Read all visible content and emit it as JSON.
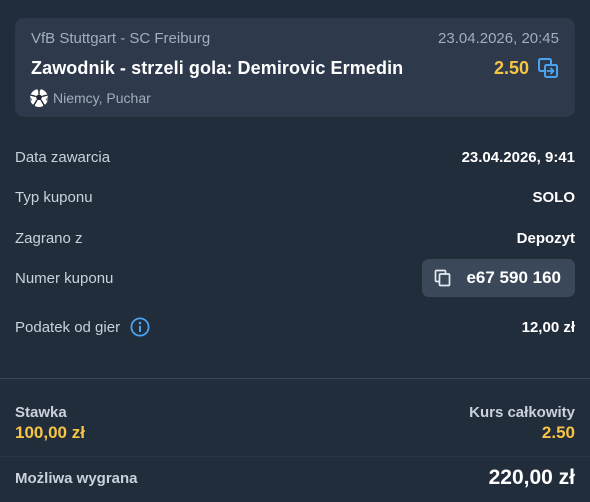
{
  "bet": {
    "match": "VfB Stuttgart - SC Freiburg",
    "datetime": "23.04.2026, 20:45",
    "selection": "Zawodnik - strzeli gola: Demirovic Ermedin",
    "odds": "2.50",
    "league": "Niemcy, Puchar",
    "sport_icon": "soccer-ball-icon"
  },
  "details": {
    "placed_label": "Data zawarcia",
    "placed_value": "23.04.2026, 9:41",
    "type_label": "Typ kuponu",
    "type_value": "SOLO",
    "played_from_label": "Zagrano z",
    "played_from_value": "Depozyt",
    "coupon_label": "Numer kuponu",
    "coupon_value": "e67 590 160",
    "tax_label": "Podatek od gier",
    "tax_value": "12,00 zł"
  },
  "summary": {
    "stake_label": "Stawka",
    "stake_value": "100,00 zł",
    "total_odds_label": "Kurs całkowity",
    "total_odds_value": "2.50",
    "win_label": "Możliwa wygrana",
    "win_value": "220,00 zł"
  },
  "colors": {
    "background": "#222d3c",
    "card": "#2e3a4c",
    "accent_yellow": "#f6c544",
    "accent_blue": "#4aa3f0"
  }
}
